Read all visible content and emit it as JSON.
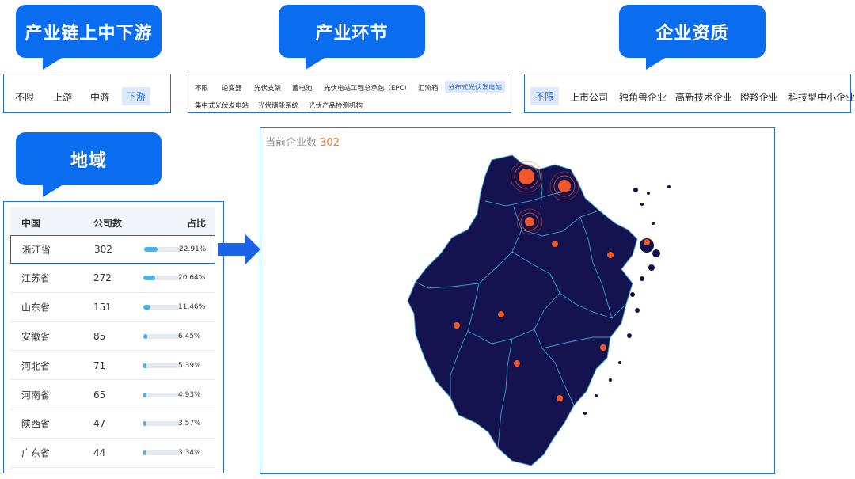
{
  "chain": {
    "title": "产业链上中下游",
    "options": [
      "不限",
      "上游",
      "中游",
      "下游"
    ],
    "selected": "下游"
  },
  "links": {
    "title": "产业环节",
    "options": [
      "不限",
      "逆变器",
      "光伏支架",
      "蓄电池",
      "光伏电站工程总承包（EPC）",
      "汇流箱",
      "分布式光伏发电站",
      "集中式光伏发电站",
      "光伏储能系统",
      "光伏产品检测机构"
    ],
    "selected": "分布式光伏发电站"
  },
  "qualification": {
    "title": "企业资质",
    "options": [
      "不限",
      "上市公司",
      "独角兽企业",
      "高新技术企业",
      "瞪羚企业",
      "科技型中小企业"
    ],
    "selected": "不限"
  },
  "region": {
    "title": "地域",
    "headers": [
      "中国",
      "公司数",
      "占比"
    ],
    "rows": [
      {
        "name": "浙江省",
        "count": "302",
        "pct": "22.91%",
        "ratio": 0.2291
      },
      {
        "name": "江苏省",
        "count": "272",
        "pct": "20.64%",
        "ratio": 0.2064
      },
      {
        "name": "山东省",
        "count": "151",
        "pct": "11.46%",
        "ratio": 0.1146
      },
      {
        "name": "安徽省",
        "count": "85",
        "pct": "6.45%",
        "ratio": 0.0645
      },
      {
        "name": "河北省",
        "count": "71",
        "pct": "5.39%",
        "ratio": 0.0539
      },
      {
        "name": "河南省",
        "count": "65",
        "pct": "4.93%",
        "ratio": 0.0493
      },
      {
        "name": "陕西省",
        "count": "47",
        "pct": "3.57%",
        "ratio": 0.0357
      },
      {
        "name": "广东省",
        "count": "44",
        "pct": "3.34%",
        "ratio": 0.0334
      }
    ],
    "highlighted": "浙江省"
  },
  "map": {
    "count_label": "当前企业数",
    "count_value": "302",
    "fill_color": "#14124f",
    "border_color": "#3aa0c8",
    "marker_color": "#f0582a"
  }
}
